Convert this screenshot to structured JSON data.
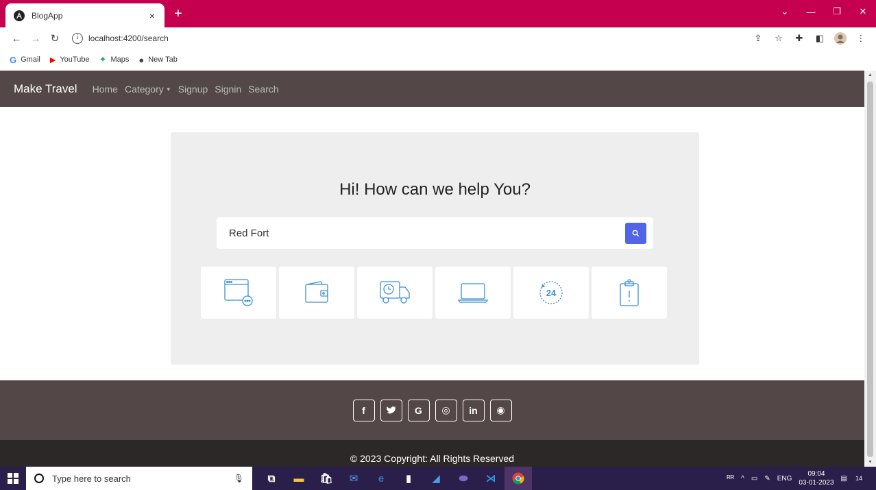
{
  "browser": {
    "tab_title": "BlogApp",
    "tab_close": "×",
    "new_tab": "+",
    "url": "localhost:4200/search",
    "bookmarks": [
      {
        "label": "Gmail",
        "icon": "G",
        "color": "#4285f4"
      },
      {
        "label": "YouTube",
        "icon": "▶",
        "color": "#ff0000"
      },
      {
        "label": "Maps",
        "icon": "✦",
        "color": "#34a853"
      },
      {
        "label": "New Tab",
        "icon": "●",
        "color": "#444444"
      }
    ]
  },
  "navbar": {
    "brand": "Make Travel",
    "links": [
      "Home",
      "Category",
      "Signup",
      "Signin",
      "Search"
    ]
  },
  "hero": {
    "title": "Hi! How can we help You?",
    "search_value": "Red Fort",
    "cards": [
      "browser-window-icon",
      "wallet-icon",
      "delivery-truck-icon",
      "laptop-icon",
      "24-hours-icon",
      "clipboard-icon"
    ],
    "card_24_label": "24"
  },
  "footer": {
    "socials": [
      {
        "name": "facebook",
        "glyph": "f"
      },
      {
        "name": "twitter",
        "glyph": "🐦"
      },
      {
        "name": "google",
        "glyph": "G"
      },
      {
        "name": "instagram",
        "glyph": "◎"
      },
      {
        "name": "linkedin",
        "glyph": "in"
      },
      {
        "name": "github",
        "glyph": "◉"
      }
    ],
    "copyright": "© 2023 Copyright: All Rights Reserved"
  },
  "taskbar": {
    "search_placeholder": "Type here to search",
    "language": "ENG",
    "time": "09:04",
    "date": "03-01-2023",
    "notifications": "14"
  },
  "colors": {
    "tabstrip": "#c4004f",
    "navbar": "#534747",
    "accent": "#5264e8",
    "icon_blue": "#3b8fd4"
  }
}
